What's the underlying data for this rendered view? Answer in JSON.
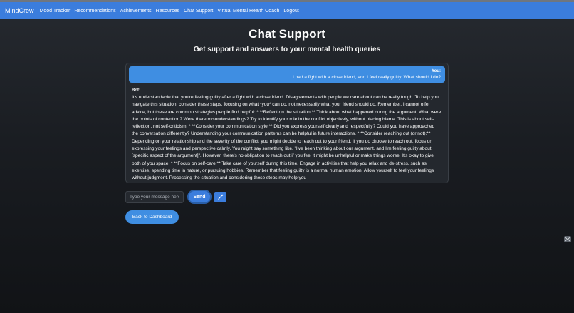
{
  "navbar": {
    "brand": "MindCrew",
    "links": [
      "Mood Tracker",
      "Recommendations",
      "Achievements",
      "Resources",
      "Chat Support",
      "Virtual Mental Health Coach",
      "Logout"
    ]
  },
  "page": {
    "title": "Chat Support",
    "subtitle": "Get support and answers to your mental health queries"
  },
  "chat": {
    "user_sender": "You:",
    "user_message": "I had a fight with a close friend, and I feel really guilty. What should I do?",
    "bot_sender": "Bot:",
    "bot_message": "It's understandable that you're feeling guilty after a fight with a close friend. Disagreements with people we care about can be really tough. To help you navigate this situation, consider these steps, focusing on what *you* can do, not necessarily what your friend should do. Remember, I cannot offer advice, but these are common strategies people find helpful: * **Reflect on the situation:** Think about what happened during the argument. What were the points of contention? Were there misunderstandings? Try to identify your role in the conflict objectively, without placing blame. This is about self-reflection, not self-criticism. * **Consider your communication style:** Did you express yourself clearly and respectfully? Could you have approached the conversation differently? Understanding your communication patterns can be helpful in future interactions. * **Consider reaching out (or not):** Depending on your relationship and the severity of the conflict, you might decide to reach out to your friend. If you do choose to reach out, focus on expressing your feelings and perspective calmly. You might say something like, \"I've been thinking about our argument, and I'm feeling guilty about [specific aspect of the argument]\". However, there's no obligation to reach out if you feel it might be unhelpful or make things worse. It's okay to give both of you space. * **Focus on self-care:** Take care of yourself during this time. Engage in activities that help you relax and de-stress, such as exercise, spending time in nature, or pursuing hobbies. Remember that feeling guilty is a normal human emotion. Allow yourself to feel your feelings without judgment. Processing the situation and considering these steps may help you"
  },
  "controls": {
    "input_placeholder": "Type your message here...",
    "send_label": "Send",
    "mic_icon": "microphone-icon",
    "dashboard_label": "Back to Dashboard",
    "corner_icon": "widget-icon"
  },
  "colors": {
    "navbar": "#3b7ddd",
    "user_bubble": "#3f8ee2",
    "chat_bg": "#24282e"
  }
}
